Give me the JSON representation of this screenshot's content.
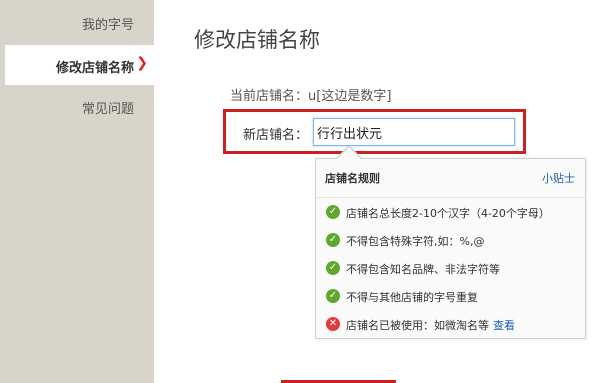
{
  "sidebar": {
    "items": [
      {
        "label": "我的字号"
      },
      {
        "label": "修改店铺名称",
        "chevron": "❯"
      },
      {
        "label": "常见问题"
      }
    ]
  },
  "page_title": "修改店铺名称",
  "current_name": {
    "label": "当前店铺名：",
    "value": "u[这边是数字]"
  },
  "new_name": {
    "label": "新店铺名：",
    "value": "行行出状元"
  },
  "rules_popup": {
    "title": "店铺名规则",
    "tips_link": "小贴士",
    "rules": [
      {
        "status": "ok",
        "icon": "check-icon",
        "text": "店铺名总长度2-10个汉字（4-20个字母）"
      },
      {
        "status": "ok",
        "icon": "check-icon",
        "text": "不得包含特殊字符,如：%,@"
      },
      {
        "status": "ok",
        "icon": "check-icon",
        "text": "不得包含知名品牌、非法字符等"
      },
      {
        "status": "ok",
        "icon": "check-icon",
        "text": "不得与其他店铺的字号重复"
      },
      {
        "status": "error",
        "icon": "error-icon",
        "text": "店铺名已被使用：如微淘名等",
        "link": "查看"
      }
    ]
  },
  "colors": {
    "sidebar_bg": "#d9d4ca",
    "accent_red": "#cc1f1f",
    "link_blue": "#1a5fb4",
    "ok_green": "#5fa82f",
    "error_red": "#e03c3c"
  }
}
